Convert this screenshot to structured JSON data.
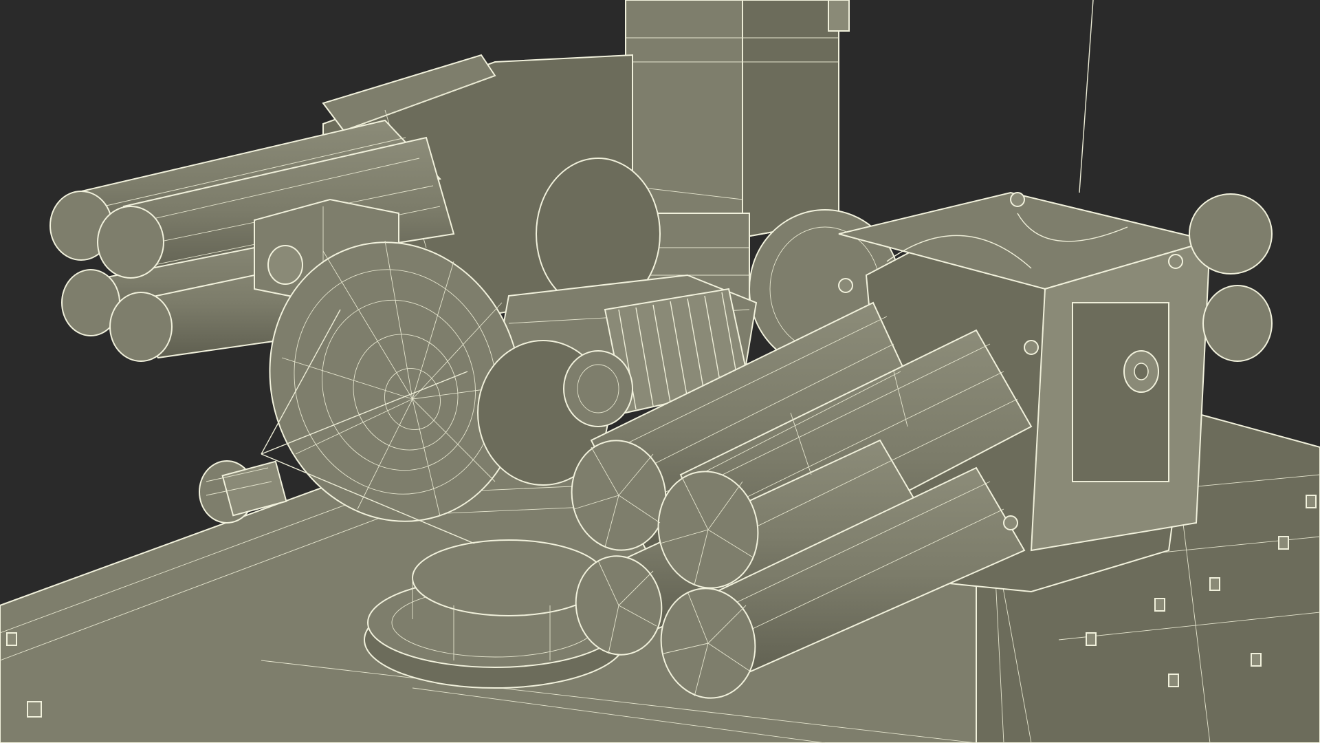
{
  "scene": {
    "background_color": "#2a2a2a",
    "model_color": "#7e7e6c",
    "wire_color": "#eeeed8"
  }
}
